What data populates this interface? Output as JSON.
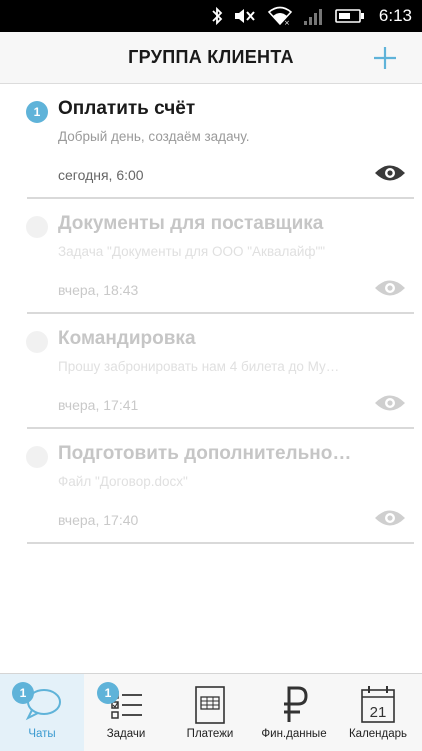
{
  "status_bar": {
    "time": "6:13"
  },
  "header": {
    "title": "ГРУППА КЛИЕНТА"
  },
  "items": [
    {
      "badge": "1",
      "title": "Оплатить счёт",
      "subtitle": "Добрый день, создаём задачу.",
      "time": "сегодня, 6:00"
    },
    {
      "badge": "",
      "title": "Документы для поставщика",
      "subtitle": "Задача \"Документы для ООО \"Аквалайф\"\"",
      "time": "вчера, 18:43"
    },
    {
      "badge": "",
      "title": "Командировка",
      "subtitle": "Прошу забронировать нам 4 билета до Му…",
      "time": "вчера, 17:41"
    },
    {
      "badge": "",
      "title": "Подготовить дополнительно…",
      "subtitle": "Файл \"Договор.docx\"",
      "time": "вчера, 17:40"
    }
  ],
  "tabs": [
    {
      "label": "Чаты",
      "badge": "1"
    },
    {
      "label": "Задачи",
      "badge": "1"
    },
    {
      "label": "Платежи"
    },
    {
      "label": "Фин.данные"
    },
    {
      "label": "Календарь",
      "day": "21"
    }
  ],
  "colors": {
    "accent": "#5fb3d9",
    "tab_selected_bg": "#e4f1f9"
  }
}
